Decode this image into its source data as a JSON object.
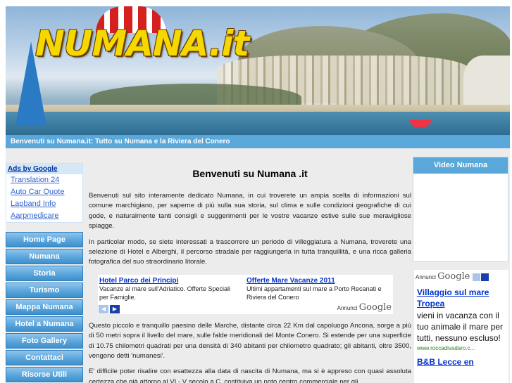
{
  "header": {
    "logo": "NUMANA.it",
    "tagline": "Benvenuti su Numana.it: Tutto su Numana e la Riviera del Conero"
  },
  "ads_box": {
    "title": "Ads by Google",
    "links": [
      "Translation 24",
      "Auto Car Quote",
      "Lapband Info",
      "Aarpmedicare"
    ]
  },
  "menu": [
    "Home Page",
    "Numana",
    "Storia",
    "Turismo",
    "Mappa Numana",
    "Hotel a Numana",
    "Foto Gallery",
    "Contattaci",
    "Risorse Utili"
  ],
  "main": {
    "title": "Benvenuti su Numana .it",
    "p1": "Benvenuti sul sito interamente dedicato Numana, in cui troverete un ampia scelta di informazioni sul comune marchigiano, per saperne di più sulla sua storia, sul clima e sulle condizioni geografiche di cui gode, e naturalmente tanti consigli e suggerimenti per le vostre vacanze estive sulle sue meravigliose spiagge.",
    "p2": "In particolar modo, se siete interessati a trascorrere un periodo di villeggiatura a Numana, troverete una selezione di Hotel e Alberghi, il percorso stradale per raggiungerla in tutta tranquillità, e una ricca galleria fotografica del suo straordinario litorale.",
    "p3": "Questo piccolo e tranquillo paesino delle Marche, distante circa 22 Km dal capoluogo Ancona, sorge a più di 50 metri sopra il livello del mare, sulle falde meridionali del Monte Conero. Si estende per una superficie di 10.75 chilometri quadrati per una densità di 340 abitanti per chilometro quadrato; gli abitanti, oltre 3500, vengono detti 'numanesi'.",
    "p4": "E' difficile poter risalire con esattezza alla data di nascita di Numana, ma si è appreso con quasi assoluta certezza che già attorno al VI - V secolo a.C. costituiva un noto centro commerciale per gli"
  },
  "ad_unit": {
    "ad1_title": "Hotel Parco dei Principi",
    "ad1_desc": "Vacanze al mare sull'Adriatico. Offerte Speciali per Famiglie.",
    "ad2_title": "Offerte Mare Vacanze 2011",
    "ad2_desc": "Ultimi appartamenti sul mare a Porto Recanati e Riviera del Conero",
    "annunci": "Annunci",
    "google": "Google"
  },
  "video": {
    "title": "Video Numana"
  },
  "right_ads": {
    "annunci": "Annunci",
    "google": "Google",
    "ad1_title": "Villaggio sul mare Tropea",
    "ad1_desc": "vieni in vacanza con il tuo animale il mare per tutti, nessuno escluso!",
    "ad1_url": "www.roccadivadaro.c...",
    "ad2_title": "B&B Lecce en"
  }
}
